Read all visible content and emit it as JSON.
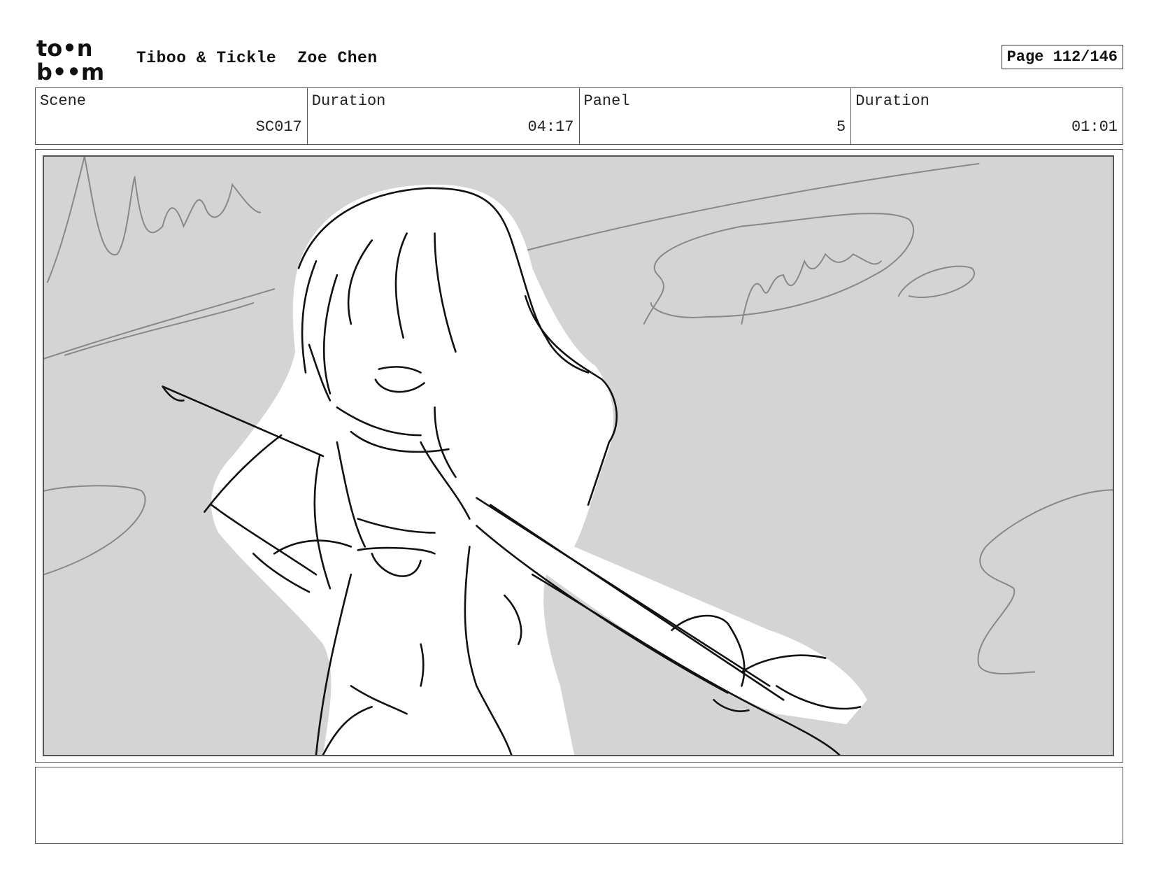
{
  "header": {
    "logo_top": "to•n",
    "logo_bottom": "b••m",
    "project_title": "Tiboo & Tickle",
    "artist": "Zoe Chen",
    "page_label": "Page 112/146"
  },
  "info": {
    "scene_label": "Scene",
    "scene_value": "SC017",
    "scene_duration_label": "Duration",
    "scene_duration_value": "04:17",
    "panel_label": "Panel",
    "panel_value": "5",
    "panel_duration_label": "Duration",
    "panel_duration_value": "01:01"
  },
  "panel": {
    "background_color": "#d4d4d4",
    "sketch_line_color": "#111111",
    "rough_line_color": "#888888"
  },
  "notes": {
    "text": ""
  }
}
